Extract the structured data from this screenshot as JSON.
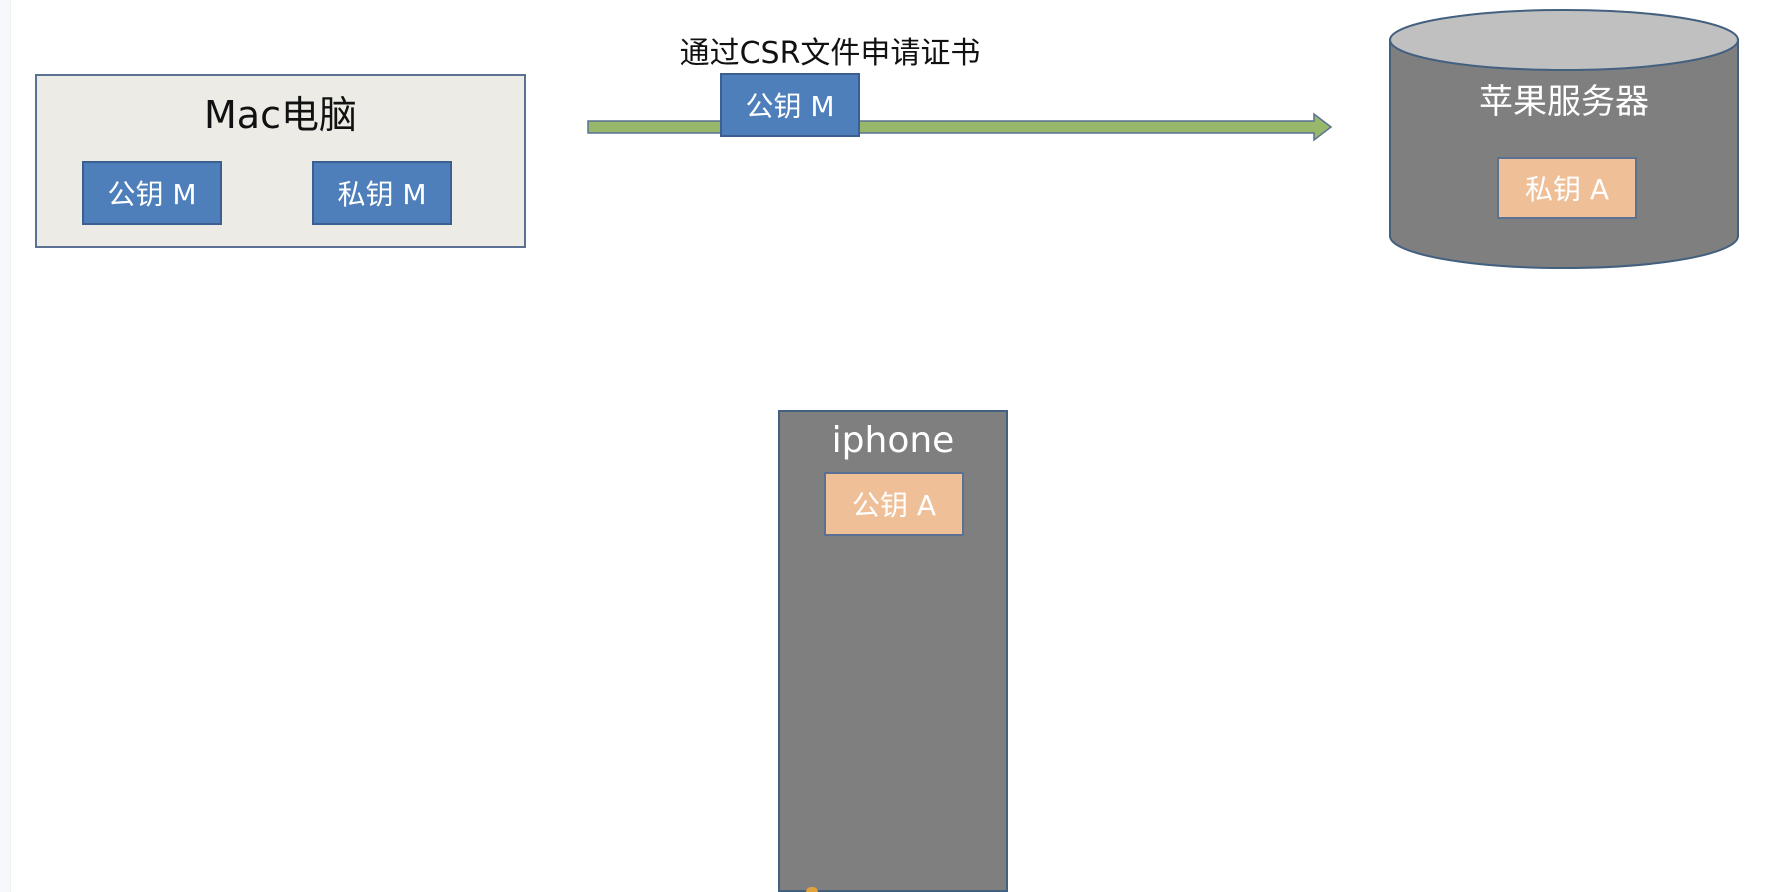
{
  "mac": {
    "title": "Mac电脑",
    "public_key": "公钥 M",
    "private_key": "私钥 M"
  },
  "transfer": {
    "label": "通过CSR文件申请证书",
    "public_key": "公钥 M"
  },
  "server": {
    "title": "苹果服务器",
    "private_key": "私钥 A"
  },
  "iphone": {
    "title": "iphone",
    "public_key": "公钥 A"
  },
  "colors": {
    "mac_box_bg": "#ecebe6",
    "blue_key": "#4f7fba",
    "orange_key": "#efc098",
    "arrow_green": "#97b86a",
    "server_body": "#7f7f80",
    "server_top": "#c0c0c0"
  }
}
